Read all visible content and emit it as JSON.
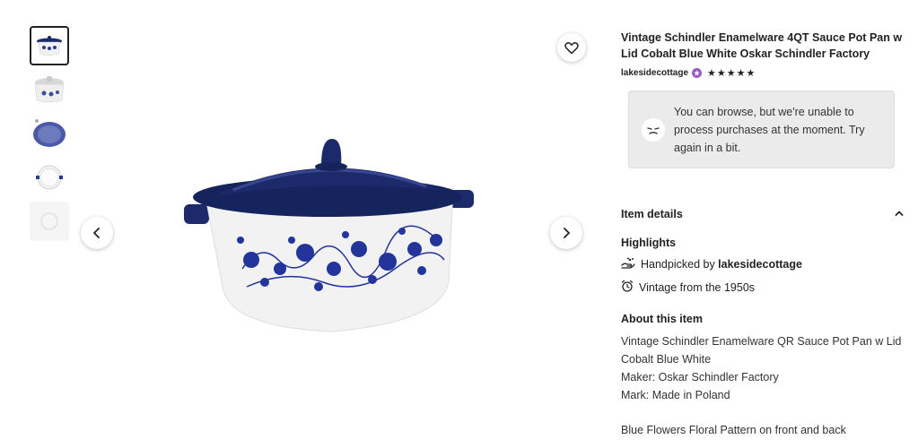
{
  "listing": {
    "title": "Vintage Schindler Enamelware 4QT Sauce Pot Pan w Lid Cobalt Blue White Oskar Schindler Factory",
    "shop_name": "lakesidecottage",
    "stars": "★★★★★",
    "rating": 5
  },
  "notice": {
    "text": "You can browse, but we're unable to process purchases at the moment. Try again in a bit."
  },
  "item_details": {
    "header": "Item details",
    "highlights_label": "Highlights",
    "handpicked_prefix": "Handpicked by ",
    "handpicked_shop": "lakesidecottage",
    "vintage": "Vintage from the 1950s",
    "about_label": "About this item",
    "about_lines": [
      "Vintage Schindler Enamelware QR Sauce Pot Pan w Lid",
      "Cobalt Blue White",
      "Maker: Oskar Schindler Factory",
      "Mark: Made in Poland",
      "Blue Flowers Floral Pattern on front and back"
    ]
  },
  "colors": {
    "cobalt": "#1c2a6b",
    "star_seller": "#9b59c7",
    "notice_bg": "#ebebeb"
  },
  "icons": {
    "prev": "chevron-left-icon",
    "next": "chevron-right-icon",
    "favorite": "heart-icon",
    "handpicked": "hand-icon",
    "vintage": "alarm-clock-icon"
  }
}
